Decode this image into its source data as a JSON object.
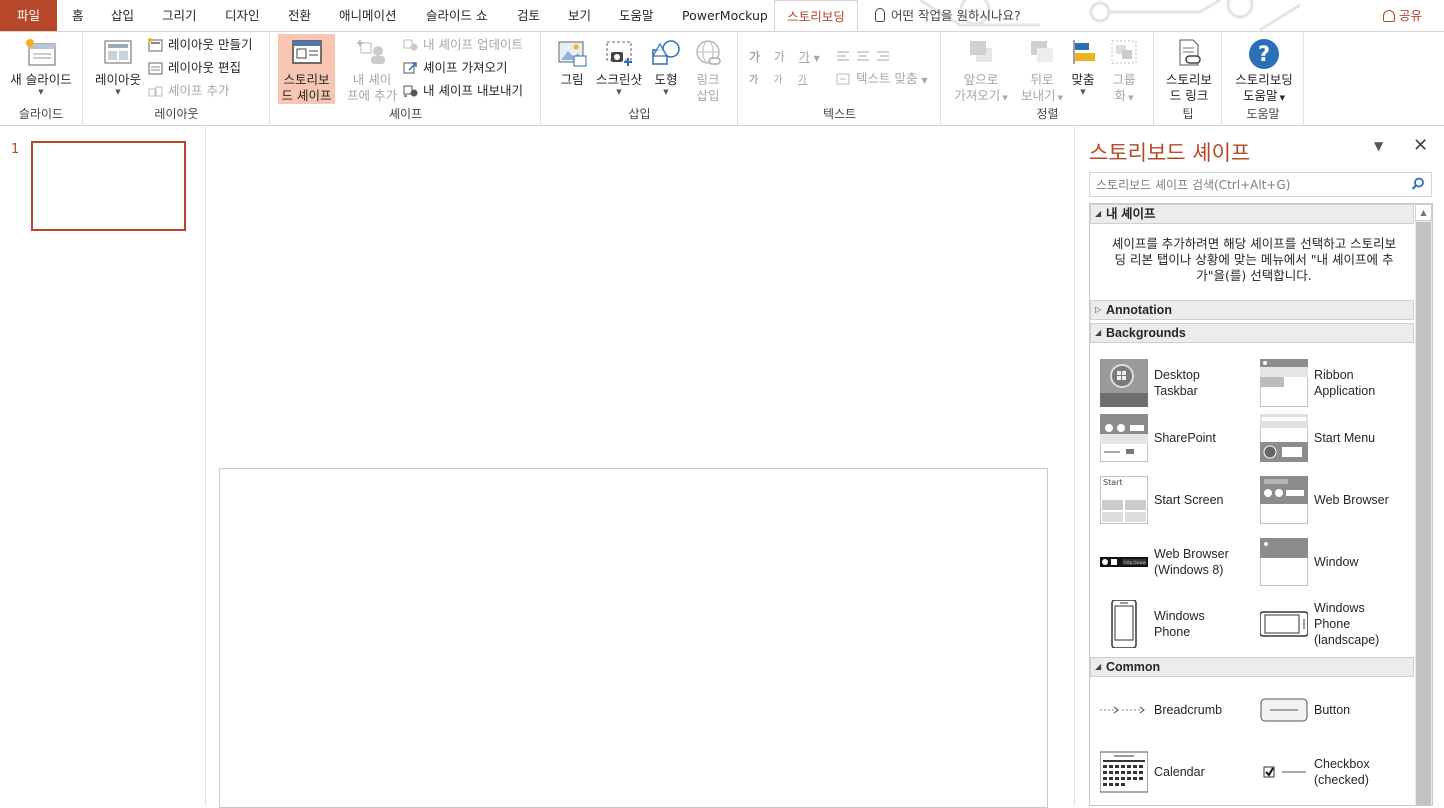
{
  "tabs": {
    "file": "파일",
    "items": [
      "홈",
      "삽입",
      "그리기",
      "디자인",
      "전환",
      "애니메이션",
      "슬라이드 쇼",
      "검토",
      "보기",
      "도움말",
      "PowerMockup"
    ],
    "active": "스토리보딩",
    "tell_me": "어떤 작업을 원하시나요?",
    "share": "공유"
  },
  "ribbon": {
    "slide_group": {
      "label": "슬라이드",
      "new_slide": "새 슬라이드"
    },
    "layout_group": {
      "label": "레이아웃",
      "layout": "레이아웃",
      "make_layout": "레이아웃 만들기",
      "edit_layout": "레이아웃 편집",
      "add_shape": "셰이프 추가"
    },
    "shape_group": {
      "label": "셰이프",
      "storyboard_shape_1": "스토리보",
      "storyboard_shape_2": "드 셰이프",
      "add_my_shape_1": "내 셰이",
      "add_my_shape_2": "프에 추가",
      "update_my_shape": "내 셰이프 업데이트",
      "import_shape": "셰이프 가져오기",
      "export_shape": "내 셰이프 내보내기"
    },
    "insert_group": {
      "label": "삽입",
      "picture": "그림",
      "screenshot": "스크린샷",
      "shapes": "도형",
      "link_1": "링크",
      "link_2": "삽입"
    },
    "text_group": {
      "label": "텍스트",
      "ga1": "가",
      "ga2": "가",
      "ga3": "가",
      "ga4": "가",
      "ga5": "가",
      "ga6": "가",
      "fit_text": "텍스트 맞춤"
    },
    "arrange_group": {
      "label": "정렬",
      "bring_forward_1": "앞으로",
      "bring_forward_2": "가져오기",
      "send_back_1": "뒤로",
      "send_back_2": "보내기",
      "align": "맞춤",
      "group_1": "그룹",
      "group_2": "화"
    },
    "tip_group": {
      "label": "팁",
      "link_1": "스토리보",
      "link_2": "드 링크"
    },
    "help_group": {
      "label": "도움말",
      "help_1": "스토리보딩",
      "help_2": "도움말"
    }
  },
  "slides": {
    "number": "1"
  },
  "pane": {
    "title": "스토리보드 셰이프",
    "search_placeholder": "스토리보드 셰이프 검색(Ctrl+Alt+G)",
    "my_shapes": {
      "header": "내 셰이프",
      "desc_1": "셰이프를 추가하려면 해당 셰이프를 선택하고 스토리보",
      "desc_2": "딩 리본 탭이나 상황에 맞는 메뉴에서 \"내 셰이프에 추",
      "desc_3": "가\"을(를) 선택합니다."
    },
    "annotation": {
      "header": "Annotation"
    },
    "backgrounds": {
      "header": "Backgrounds",
      "items": [
        [
          "Desktop",
          "Taskbar"
        ],
        [
          "Ribbon",
          "Application"
        ],
        [
          "SharePoint"
        ],
        [
          "Start Menu"
        ],
        [
          "Start Screen"
        ],
        [
          "Web Browser"
        ],
        [
          "Web Browser",
          "(Windows 8)"
        ],
        [
          "Window"
        ],
        [
          "Windows",
          "Phone"
        ],
        [
          "Windows",
          "Phone",
          "(landscape)"
        ]
      ]
    },
    "common": {
      "header": "Common",
      "items": [
        [
          "Breadcrumb"
        ],
        [
          "Button"
        ],
        [
          "Calendar"
        ],
        [
          "Checkbox",
          "(checked)"
        ]
      ]
    }
  },
  "colors": {
    "accent": "#b7472a",
    "selected_button": "#f8c6b3"
  }
}
